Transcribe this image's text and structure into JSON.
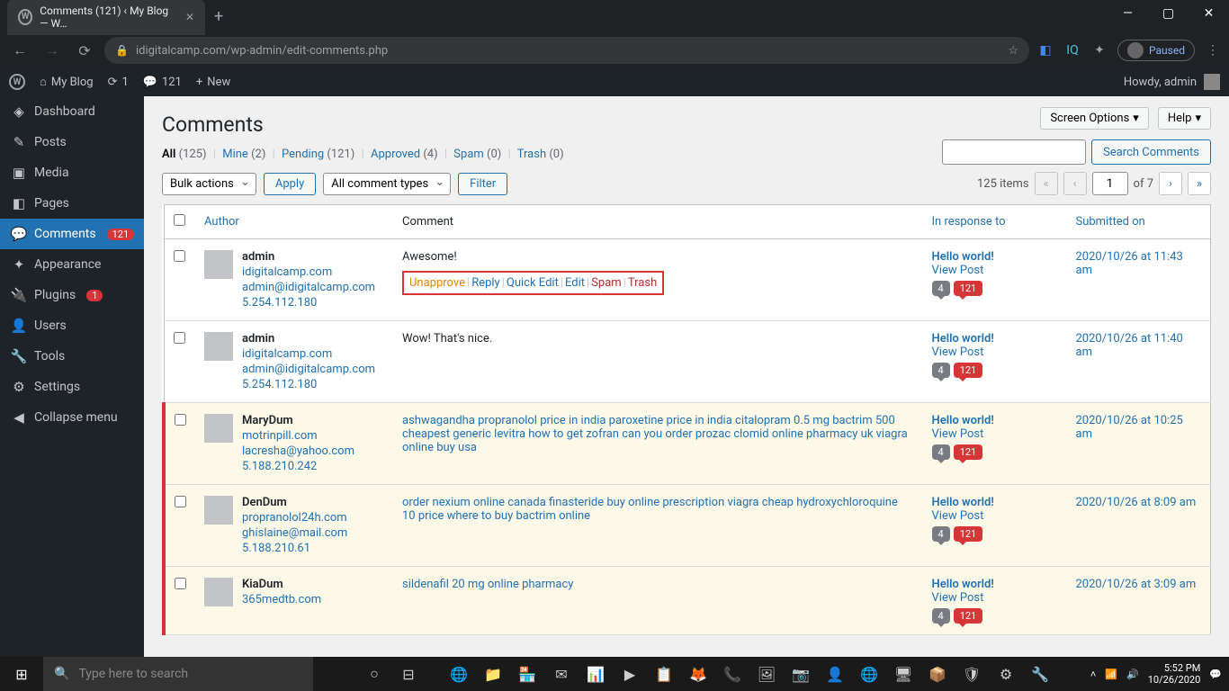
{
  "browser": {
    "tab_title": "Comments (121) ‹ My Blog — W…",
    "url": "idigitalcamp.com/wp-admin/edit-comments.php",
    "paused": "Paused"
  },
  "admin_bar": {
    "site_name": "My Blog",
    "updates": "1",
    "comments": "121",
    "new": "New",
    "howdy": "Howdy, admin"
  },
  "sidebar": {
    "items": [
      {
        "icon": "◈",
        "label": "Dashboard"
      },
      {
        "icon": "✎",
        "label": "Posts"
      },
      {
        "icon": "▣",
        "label": "Media"
      },
      {
        "icon": "◧",
        "label": "Pages"
      },
      {
        "icon": "💬",
        "label": "Comments",
        "badge": "121",
        "active": true
      },
      {
        "icon": "✦",
        "label": "Appearance"
      },
      {
        "icon": "🔌",
        "label": "Plugins",
        "badge": "1"
      },
      {
        "icon": "👤",
        "label": "Users"
      },
      {
        "icon": "🔧",
        "label": "Tools"
      },
      {
        "icon": "⚙",
        "label": "Settings"
      },
      {
        "icon": "◀",
        "label": "Collapse menu"
      }
    ]
  },
  "page": {
    "title": "Comments",
    "screen_options": "Screen Options",
    "help": "Help",
    "search_btn": "Search Comments"
  },
  "filters": {
    "all": "All",
    "all_count": "(125)",
    "mine": "Mine",
    "mine_count": "(2)",
    "pending": "Pending",
    "pending_count": "(121)",
    "approved": "Approved",
    "approved_count": "(4)",
    "spam": "Spam",
    "spam_count": "(0)",
    "trash": "Trash",
    "trash_count": "(0)"
  },
  "toolbar": {
    "bulk": "Bulk actions",
    "apply": "Apply",
    "types": "All comment types",
    "filter": "Filter",
    "items_count": "125 items",
    "page_current": "1",
    "page_total": "of 7"
  },
  "columns": {
    "author": "Author",
    "comment": "Comment",
    "response": "In response to",
    "submitted": "Submitted on"
  },
  "row_actions": {
    "unapprove": "Unapprove",
    "reply": "Reply",
    "quick_edit": "Quick Edit",
    "edit": "Edit",
    "spam": "Spam",
    "trash": "Trash"
  },
  "response": {
    "post": "Hello world!",
    "view": "View Post",
    "count": "4",
    "pending": "121"
  },
  "comments": [
    {
      "name": "admin",
      "site": "idigitalcamp.com",
      "email": "admin@idigitalcamp.com",
      "ip": "5.254.112.180",
      "text": "Awesome!",
      "date": "2020/10/26 at 11:43 am",
      "pending": false,
      "show_actions": true,
      "normal": true
    },
    {
      "name": "admin",
      "site": "idigitalcamp.com",
      "email": "admin@idigitalcamp.com",
      "ip": "5.254.112.180",
      "text": "Wow! That's nice.",
      "date": "2020/10/26 at 11:40 am",
      "pending": false,
      "normal": true
    },
    {
      "name": "MaryDum",
      "site": "motrinpill.com",
      "email": "lacresha@yahoo.com",
      "ip": "5.188.210.242",
      "text": "ashwagandha propranolol price in india paroxetine price in india citalopram 0.5 mg bactrim 500 cheapest generic levitra how to get zofran can you order prozac clomid online pharmacy uk viagra online buy usa",
      "date": "2020/10/26 at 10:25 am",
      "pending": true
    },
    {
      "name": "DenDum",
      "site": "propranolol24h.com",
      "email": "ghislaine@mail.com",
      "ip": "5.188.210.61",
      "text": "order nexium online canada finasteride buy online prescription viagra cheap hydroxychloroquine 10 price where to buy bactrim online",
      "date": "2020/10/26 at 8:09 am",
      "pending": true
    },
    {
      "name": "KiaDum",
      "site": "365medtb.com",
      "email": "",
      "ip": "",
      "text": "sildenafil 20 mg online pharmacy",
      "date": "2020/10/26 at 3:09 am",
      "pending": true
    }
  ],
  "taskbar": {
    "search_placeholder": "Type here to search",
    "time": "5:52 PM",
    "date": "10/26/2020"
  }
}
